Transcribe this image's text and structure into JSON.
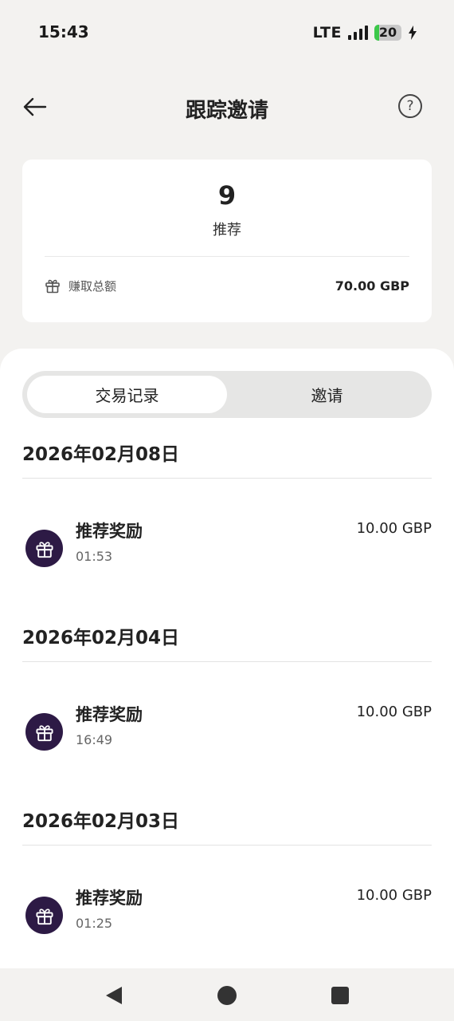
{
  "status_bar": {
    "time": "15:43",
    "network": "LTE",
    "battery_level": "20",
    "battery_color": "#3cc84a"
  },
  "header": {
    "title": "跟踪邀请",
    "back_icon": "arrow-left-icon",
    "help_icon": "question-circle-icon",
    "help_glyph": "?"
  },
  "summary": {
    "referral_count": "9",
    "referral_label": "推荐",
    "earned_icon": "gift-icon",
    "earned_label": "赚取总额",
    "earned_value": "70.00 GBP"
  },
  "tabs": [
    {
      "label": "交易记录",
      "active": true
    },
    {
      "label": "邀请",
      "active": false
    }
  ],
  "groups": [
    {
      "date": "2026年02月08日",
      "items": [
        {
          "title": "推荐奖励",
          "time": "01:53",
          "amount": "10.00 GBP",
          "icon": "gift-icon"
        }
      ]
    },
    {
      "date": "2026年02月04日",
      "items": [
        {
          "title": "推荐奖励",
          "time": "16:49",
          "amount": "10.00 GBP",
          "icon": "gift-icon"
        }
      ]
    },
    {
      "date": "2026年02月03日",
      "items": [
        {
          "title": "推荐奖励",
          "time": "01:25",
          "amount": "10.00 GBP",
          "icon": "gift-icon"
        }
      ]
    }
  ],
  "colors": {
    "accent": "#2d1a45",
    "background": "#f3f2f0",
    "card": "#ffffff"
  },
  "nav": {
    "back": "nav-back-icon",
    "home": "nav-home-icon",
    "recents": "nav-recents-icon"
  }
}
